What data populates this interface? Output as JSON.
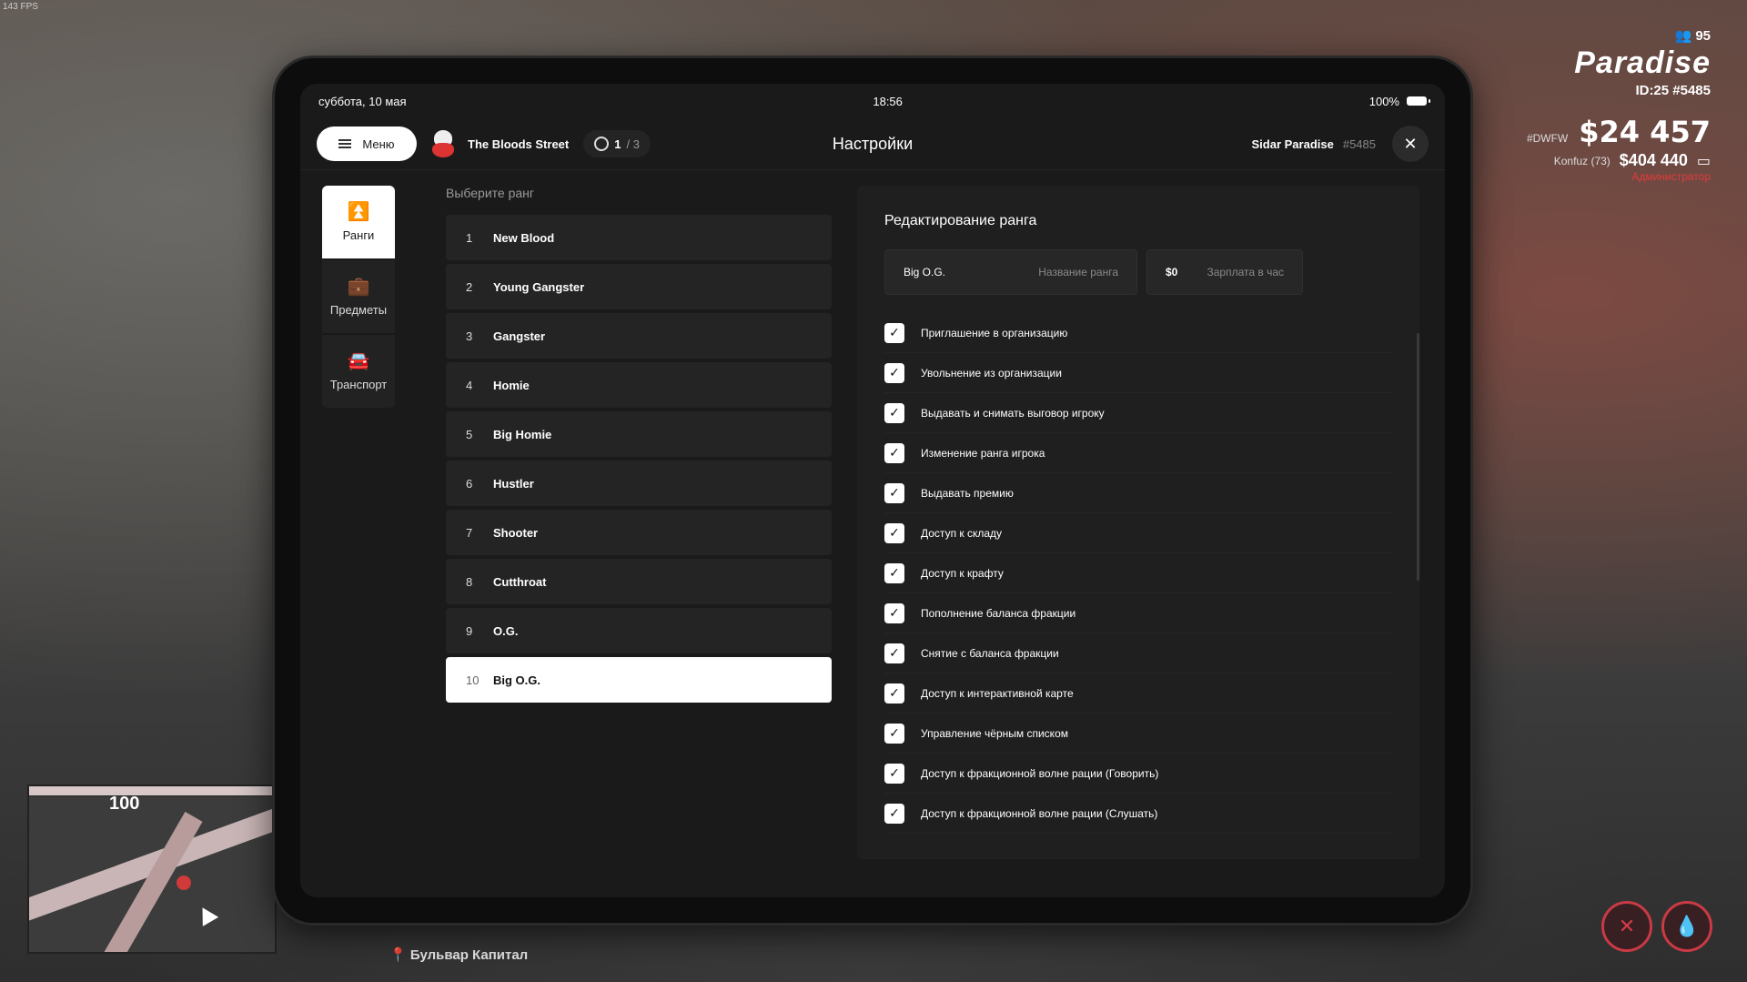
{
  "fps": "143 FPS",
  "hud": {
    "online": "95",
    "brand": "Paradise",
    "ids": "ID:25 #5485",
    "tag": "#DWFW",
    "cash": "$24 457",
    "player": "Konfuz (73)",
    "bank": "$404 440",
    "role": "Администратор"
  },
  "minimap": {
    "speed": "100",
    "street": "Бульвар Капитал"
  },
  "tablet": {
    "status": {
      "date": "суббота, 10 мая",
      "time": "18:56",
      "battery": "100%"
    },
    "topbar": {
      "menu_label": "Меню",
      "org_name": "The Bloods Street",
      "page_current": "1",
      "page_total": "/ 3",
      "title": "Настройки",
      "user_name": "Sidar Paradise",
      "user_id": "#5485",
      "close": "✕"
    },
    "nav": [
      {
        "label": "Ранги",
        "icon": "chevrons-up-icon",
        "glyph": "⌃"
      },
      {
        "label": "Предметы",
        "icon": "briefcase-icon",
        "glyph": "💼"
      },
      {
        "label": "Транспорт",
        "icon": "car-icon",
        "glyph": "🚗"
      }
    ],
    "ranks": {
      "label": "Выберите ранг",
      "items": [
        {
          "num": "1",
          "name": "New Blood"
        },
        {
          "num": "2",
          "name": "Young Gangster"
        },
        {
          "num": "3",
          "name": "Gangster"
        },
        {
          "num": "4",
          "name": "Homie"
        },
        {
          "num": "5",
          "name": "Big Homie"
        },
        {
          "num": "6",
          "name": "Hustler"
        },
        {
          "num": "7",
          "name": "Shooter"
        },
        {
          "num": "8",
          "name": "Cutthroat"
        },
        {
          "num": "9",
          "name": "O.G."
        },
        {
          "num": "10",
          "name": "Big O.G."
        }
      ],
      "selected_index": 9
    },
    "edit": {
      "title": "Редактирование ранга",
      "rank_name_value": "Big O.G.",
      "rank_name_placeholder": "Название ранга",
      "salary_value": "$0",
      "salary_placeholder": "Зарплата в час",
      "permissions": [
        {
          "label": "Приглашение в организацию",
          "checked": true
        },
        {
          "label": "Увольнение из организации",
          "checked": true
        },
        {
          "label": "Выдавать и снимать выговор игроку",
          "checked": true
        },
        {
          "label": "Изменение ранга игрока",
          "checked": true
        },
        {
          "label": "Выдавать премию",
          "checked": true
        },
        {
          "label": "Доступ к складу",
          "checked": true
        },
        {
          "label": "Доступ к крафту",
          "checked": true
        },
        {
          "label": "Пополнение баланса фракции",
          "checked": true
        },
        {
          "label": "Снятие с баланса фракции",
          "checked": true
        },
        {
          "label": "Доступ к интерактивной карте",
          "checked": true
        },
        {
          "label": "Управление чёрным списком",
          "checked": true
        },
        {
          "label": "Доступ к фракционной волне рации (Говорить)",
          "checked": true
        },
        {
          "label": "Доступ к фракционной волне рации (Слушать)",
          "checked": true
        }
      ]
    }
  },
  "colors": {
    "accent_red": "#c83a44",
    "panel": "#1a1a1a"
  }
}
